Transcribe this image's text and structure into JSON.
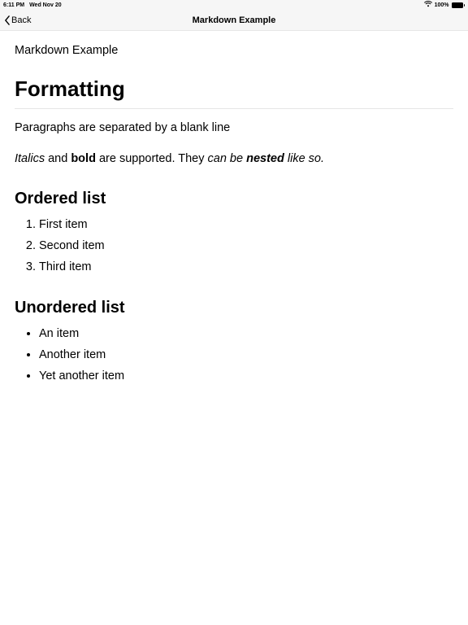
{
  "status_bar": {
    "time": "6:11 PM",
    "date": "Wed Nov 20",
    "battery_pct": "100%"
  },
  "nav": {
    "back_label": "Back",
    "title": "Markdown Example"
  },
  "doc": {
    "title": "Markdown Example",
    "h1": "Formatting",
    "para1": "Paragraphs are separated by a blank line",
    "para2": {
      "italics": "Italics",
      "and": " and ",
      "bold": "bold",
      "supported": " are supported. They ",
      "can_be": "can be ",
      "nested": "nested",
      "like_so": " like so."
    },
    "ordered_heading": "Ordered list",
    "ordered_items": [
      "First item",
      "Second item",
      "Third item"
    ],
    "unordered_heading": "Unordered list",
    "unordered_items": [
      "An item",
      "Another item",
      "Yet another item"
    ]
  }
}
